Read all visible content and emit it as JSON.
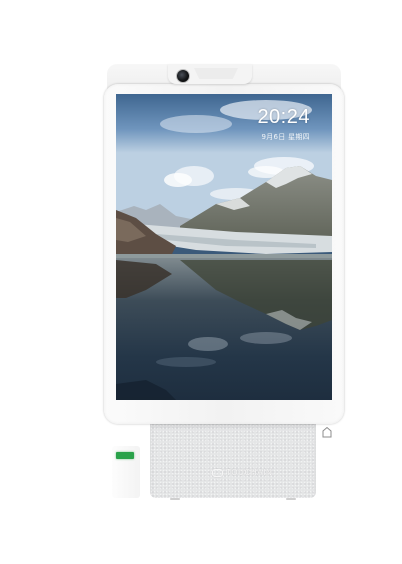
{
  "lock_screen": {
    "time": "20:24",
    "date": "9月6日 星期四",
    "wallpaper": "mountain-glacier-lake-photo"
  },
  "device": {
    "camera": "front-camera-icon",
    "home_button": "home-icon",
    "status_light_color": "#2aa24a"
  },
  "stand": {
    "brand": "TOUCHAIN"
  },
  "colors": {
    "frame": "#f4f4f4",
    "fabric": "#e4e5e6",
    "status_led": "#2aa24a"
  }
}
